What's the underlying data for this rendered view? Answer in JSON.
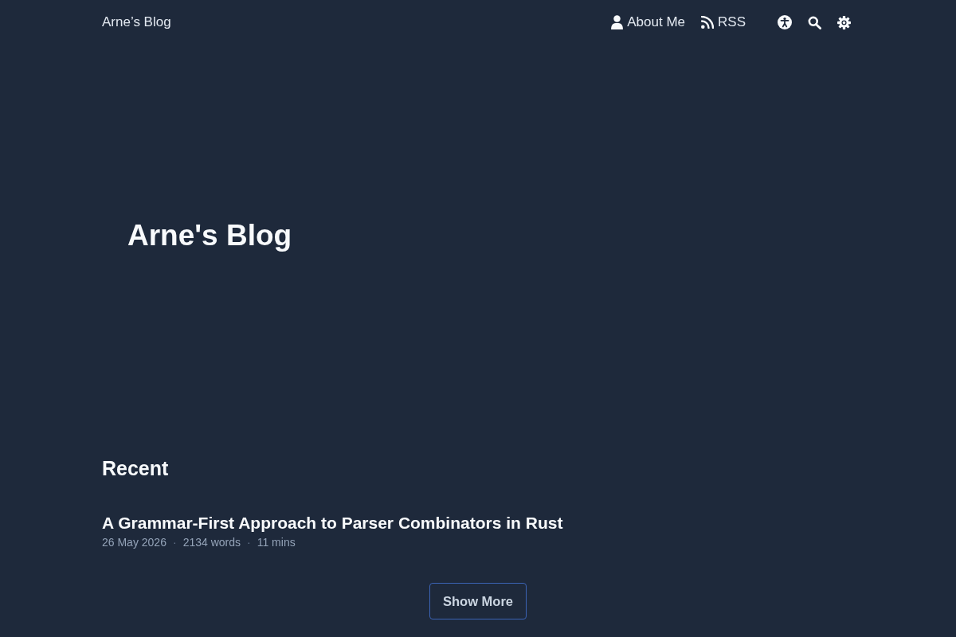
{
  "header": {
    "site_title": "Arne’s Blog",
    "nav": [
      {
        "label": "About Me"
      },
      {
        "label": "RSS"
      }
    ]
  },
  "hero": {
    "title": "Arne's Blog"
  },
  "recent": {
    "heading": "Recent",
    "posts": [
      {
        "title": "A Grammar-First Approach to Parser Combinators in Rust",
        "meta": [
          "26 May 2026",
          "2134 words",
          "11 mins"
        ]
      }
    ],
    "separator": "·"
  },
  "show_more": {
    "label": "Show More"
  }
}
